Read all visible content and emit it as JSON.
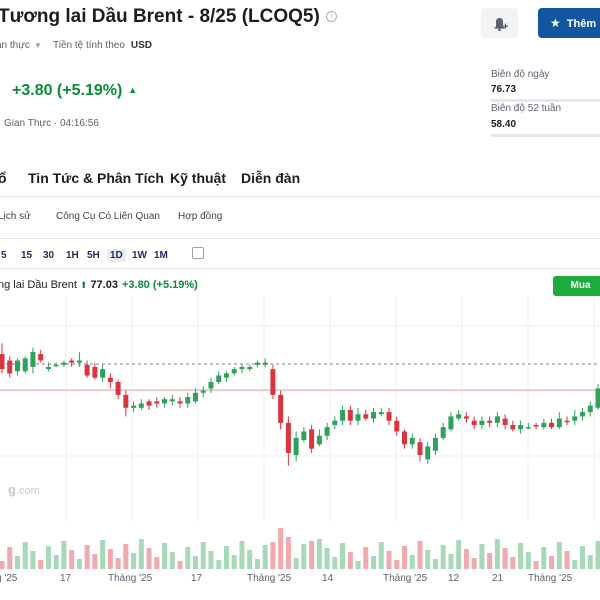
{
  "header": {
    "title": "Tương lai Dầu Brent - 8/25 (LCOQ5)",
    "info_glyph": "i",
    "meta_left": "an thực",
    "currency_label": "Tiền tệ tính theo",
    "currency": "USD",
    "follow_label": "Thêm",
    "bell_icon": "bell-plus-icon",
    "star_icon": "star-icon"
  },
  "quote": {
    "change": "+3.80 (+5.19%)",
    "realtime": "Gian Thực · 04:16:56",
    "up_color": "#0a8a3a"
  },
  "side": {
    "day_range_label": "Biên độ ngày",
    "day_low": "76.73",
    "week52_label": "Biên độ 52 tuần",
    "week52_low": "58.40"
  },
  "nav": [
    "ổ",
    "Tin Tức & Phân Tích",
    "Kỹ thuật",
    "Diễn đàn"
  ],
  "subnav": [
    "Lịch sử",
    "Công Cụ Có Liên Quan",
    "Hợp đồng"
  ],
  "timeframes": [
    "5",
    "15",
    "30",
    "1H",
    "5H",
    "1D",
    "1W",
    "1M"
  ],
  "active_timeframe": "1D",
  "instrument": {
    "name": "ng lai Dầu Brent",
    "price": "77.03",
    "change": "+3.80 (+5.19%)",
    "buy_label": "Mua"
  },
  "watermark": {
    "brand": "g",
    "suffix": ".com"
  },
  "chart_data": {
    "type": "candlestick",
    "x_tick_labels": [
      "g '25",
      "17",
      "Tháng '25",
      "17",
      "Tháng '25",
      "14",
      "Tháng '25",
      "12",
      "21",
      "Tháng '25"
    ],
    "candles": [
      {
        "o": 0.34,
        "c": 0.27,
        "h": 0.22,
        "l": 0.36,
        "dir": "down"
      },
      {
        "o": 0.3,
        "c": 0.36,
        "h": 0.28,
        "l": 0.38,
        "dir": "down"
      },
      {
        "o": 0.35,
        "c": 0.3,
        "h": 0.29,
        "l": 0.37,
        "dir": "up"
      },
      {
        "o": 0.35,
        "c": 0.29,
        "h": 0.28,
        "l": 0.36,
        "dir": "up"
      },
      {
        "o": 0.33,
        "c": 0.26,
        "h": 0.24,
        "l": 0.36,
        "dir": "up"
      },
      {
        "o": 0.27,
        "c": 0.3,
        "h": 0.25,
        "l": 0.31,
        "dir": "down"
      },
      {
        "o": 0.33,
        "c": 0.34,
        "h": 0.31,
        "l": 0.35,
        "dir": "up"
      },
      {
        "o": 0.32,
        "c": 0.32,
        "h": 0.31,
        "l": 0.33,
        "dir": "up"
      },
      {
        "o": 0.32,
        "c": 0.31,
        "h": 0.3,
        "l": 0.33,
        "dir": "up"
      },
      {
        "o": 0.3,
        "c": 0.31,
        "h": 0.29,
        "l": 0.33,
        "dir": "down"
      },
      {
        "o": 0.31,
        "c": 0.3,
        "h": 0.26,
        "l": 0.33,
        "dir": "up"
      },
      {
        "o": 0.32,
        "c": 0.37,
        "h": 0.3,
        "l": 0.38,
        "dir": "down"
      },
      {
        "o": 0.33,
        "c": 0.38,
        "h": 0.31,
        "l": 0.39,
        "dir": "down"
      },
      {
        "o": 0.38,
        "c": 0.34,
        "h": 0.32,
        "l": 0.4,
        "dir": "up"
      },
      {
        "o": 0.38,
        "c": 0.4,
        "h": 0.36,
        "l": 0.43,
        "dir": "down"
      },
      {
        "o": 0.4,
        "c": 0.46,
        "h": 0.39,
        "l": 0.48,
        "dir": "down"
      },
      {
        "o": 0.46,
        "c": 0.52,
        "h": 0.44,
        "l": 0.56,
        "dir": "down"
      },
      {
        "o": 0.52,
        "c": 0.51,
        "h": 0.49,
        "l": 0.54,
        "dir": "up"
      },
      {
        "o": 0.52,
        "c": 0.5,
        "h": 0.48,
        "l": 0.53,
        "dir": "up"
      },
      {
        "o": 0.51,
        "c": 0.49,
        "h": 0.48,
        "l": 0.53,
        "dir": "down"
      },
      {
        "o": 0.49,
        "c": 0.5,
        "h": 0.47,
        "l": 0.52,
        "dir": "down"
      },
      {
        "o": 0.5,
        "c": 0.48,
        "h": 0.47,
        "l": 0.52,
        "dir": "up"
      },
      {
        "o": 0.49,
        "c": 0.48,
        "h": 0.46,
        "l": 0.51,
        "dir": "up"
      },
      {
        "o": 0.49,
        "c": 0.5,
        "h": 0.47,
        "l": 0.52,
        "dir": "down"
      },
      {
        "o": 0.5,
        "c": 0.47,
        "h": 0.45,
        "l": 0.52,
        "dir": "up"
      },
      {
        "o": 0.49,
        "c": 0.45,
        "h": 0.43,
        "l": 0.5,
        "dir": "up"
      },
      {
        "o": 0.45,
        "c": 0.44,
        "h": 0.42,
        "l": 0.47,
        "dir": "up"
      },
      {
        "o": 0.43,
        "c": 0.4,
        "h": 0.38,
        "l": 0.45,
        "dir": "up"
      },
      {
        "o": 0.4,
        "c": 0.37,
        "h": 0.35,
        "l": 0.41,
        "dir": "up"
      },
      {
        "o": 0.38,
        "c": 0.36,
        "h": 0.35,
        "l": 0.4,
        "dir": "up"
      },
      {
        "o": 0.36,
        "c": 0.34,
        "h": 0.33,
        "l": 0.37,
        "dir": "up"
      },
      {
        "o": 0.34,
        "c": 0.33,
        "h": 0.32,
        "l": 0.36,
        "dir": "up"
      },
      {
        "o": 0.34,
        "c": 0.33,
        "h": 0.32,
        "l": 0.35,
        "dir": "up"
      },
      {
        "o": 0.32,
        "c": 0.31,
        "h": 0.3,
        "l": 0.33,
        "dir": "up"
      },
      {
        "o": 0.32,
        "c": 0.31,
        "h": 0.29,
        "l": 0.33,
        "dir": "up"
      },
      {
        "o": 0.34,
        "c": 0.46,
        "h": 0.32,
        "l": 0.48,
        "dir": "down"
      },
      {
        "o": 0.46,
        "c": 0.59,
        "h": 0.44,
        "l": 0.62,
        "dir": "down"
      },
      {
        "o": 0.59,
        "c": 0.73,
        "h": 0.56,
        "l": 0.79,
        "dir": "down"
      },
      {
        "o": 0.74,
        "c": 0.66,
        "h": 0.63,
        "l": 0.77,
        "dir": "up"
      },
      {
        "o": 0.67,
        "c": 0.63,
        "h": 0.61,
        "l": 0.68,
        "dir": "up"
      },
      {
        "o": 0.62,
        "c": 0.71,
        "h": 0.6,
        "l": 0.73,
        "dir": "down"
      },
      {
        "o": 0.69,
        "c": 0.65,
        "h": 0.62,
        "l": 0.7,
        "dir": "up"
      },
      {
        "o": 0.65,
        "c": 0.61,
        "h": 0.59,
        "l": 0.67,
        "dir": "up"
      },
      {
        "o": 0.6,
        "c": 0.58,
        "h": 0.56,
        "l": 0.62,
        "dir": "up"
      },
      {
        "o": 0.58,
        "c": 0.53,
        "h": 0.51,
        "l": 0.6,
        "dir": "up"
      },
      {
        "o": 0.53,
        "c": 0.58,
        "h": 0.51,
        "l": 0.6,
        "dir": "down"
      },
      {
        "o": 0.58,
        "c": 0.55,
        "h": 0.52,
        "l": 0.6,
        "dir": "up"
      },
      {
        "o": 0.55,
        "c": 0.57,
        "h": 0.53,
        "l": 0.58,
        "dir": "down"
      },
      {
        "o": 0.57,
        "c": 0.54,
        "h": 0.52,
        "l": 0.59,
        "dir": "up"
      },
      {
        "o": 0.55,
        "c": 0.54,
        "h": 0.52,
        "l": 0.56,
        "dir": "up"
      },
      {
        "o": 0.54,
        "c": 0.58,
        "h": 0.52,
        "l": 0.6,
        "dir": "down"
      },
      {
        "o": 0.58,
        "c": 0.63,
        "h": 0.56,
        "l": 0.65,
        "dir": "down"
      },
      {
        "o": 0.63,
        "c": 0.69,
        "h": 0.62,
        "l": 0.71,
        "dir": "down"
      },
      {
        "o": 0.69,
        "c": 0.66,
        "h": 0.64,
        "l": 0.71,
        "dir": "up"
      },
      {
        "o": 0.68,
        "c": 0.74,
        "h": 0.66,
        "l": 0.77,
        "dir": "down"
      },
      {
        "o": 0.76,
        "c": 0.7,
        "h": 0.68,
        "l": 0.78,
        "dir": "up"
      },
      {
        "o": 0.72,
        "c": 0.66,
        "h": 0.64,
        "l": 0.74,
        "dir": "up"
      },
      {
        "o": 0.66,
        "c": 0.61,
        "h": 0.59,
        "l": 0.67,
        "dir": "up"
      },
      {
        "o": 0.62,
        "c": 0.56,
        "h": 0.54,
        "l": 0.63,
        "dir": "up"
      },
      {
        "o": 0.57,
        "c": 0.55,
        "h": 0.53,
        "l": 0.58,
        "dir": "up"
      },
      {
        "o": 0.56,
        "c": 0.57,
        "h": 0.54,
        "l": 0.59,
        "dir": "down"
      },
      {
        "o": 0.58,
        "c": 0.6,
        "h": 0.56,
        "l": 0.62,
        "dir": "down"
      },
      {
        "o": 0.6,
        "c": 0.58,
        "h": 0.56,
        "l": 0.62,
        "dir": "up"
      },
      {
        "o": 0.58,
        "c": 0.59,
        "h": 0.56,
        "l": 0.61,
        "dir": "down"
      },
      {
        "o": 0.59,
        "c": 0.56,
        "h": 0.54,
        "l": 0.61,
        "dir": "up"
      },
      {
        "o": 0.57,
        "c": 0.6,
        "h": 0.55,
        "l": 0.62,
        "dir": "down"
      },
      {
        "o": 0.6,
        "c": 0.62,
        "h": 0.58,
        "l": 0.63,
        "dir": "down"
      },
      {
        "o": 0.62,
        "c": 0.6,
        "h": 0.58,
        "l": 0.64,
        "dir": "up"
      },
      {
        "o": 0.61,
        "c": 0.61,
        "h": 0.59,
        "l": 0.62,
        "dir": "up"
      },
      {
        "o": 0.6,
        "c": 0.6,
        "h": 0.59,
        "l": 0.62,
        "dir": "down"
      },
      {
        "o": 0.61,
        "c": 0.59,
        "h": 0.57,
        "l": 0.62,
        "dir": "up"
      },
      {
        "o": 0.59,
        "c": 0.61,
        "h": 0.57,
        "l": 0.62,
        "dir": "down"
      },
      {
        "o": 0.61,
        "c": 0.57,
        "h": 0.54,
        "l": 0.62,
        "dir": "up"
      },
      {
        "o": 0.58,
        "c": 0.58,
        "h": 0.56,
        "l": 0.6,
        "dir": "down"
      },
      {
        "o": 0.58,
        "c": 0.56,
        "h": 0.53,
        "l": 0.6,
        "dir": "up"
      },
      {
        "o": 0.56,
        "c": 0.54,
        "h": 0.52,
        "l": 0.58,
        "dir": "up"
      },
      {
        "o": 0.54,
        "c": 0.51,
        "h": 0.49,
        "l": 0.56,
        "dir": "up"
      },
      {
        "o": 0.52,
        "c": 0.43,
        "h": 0.41,
        "l": 0.53,
        "dir": "up"
      }
    ]
  }
}
